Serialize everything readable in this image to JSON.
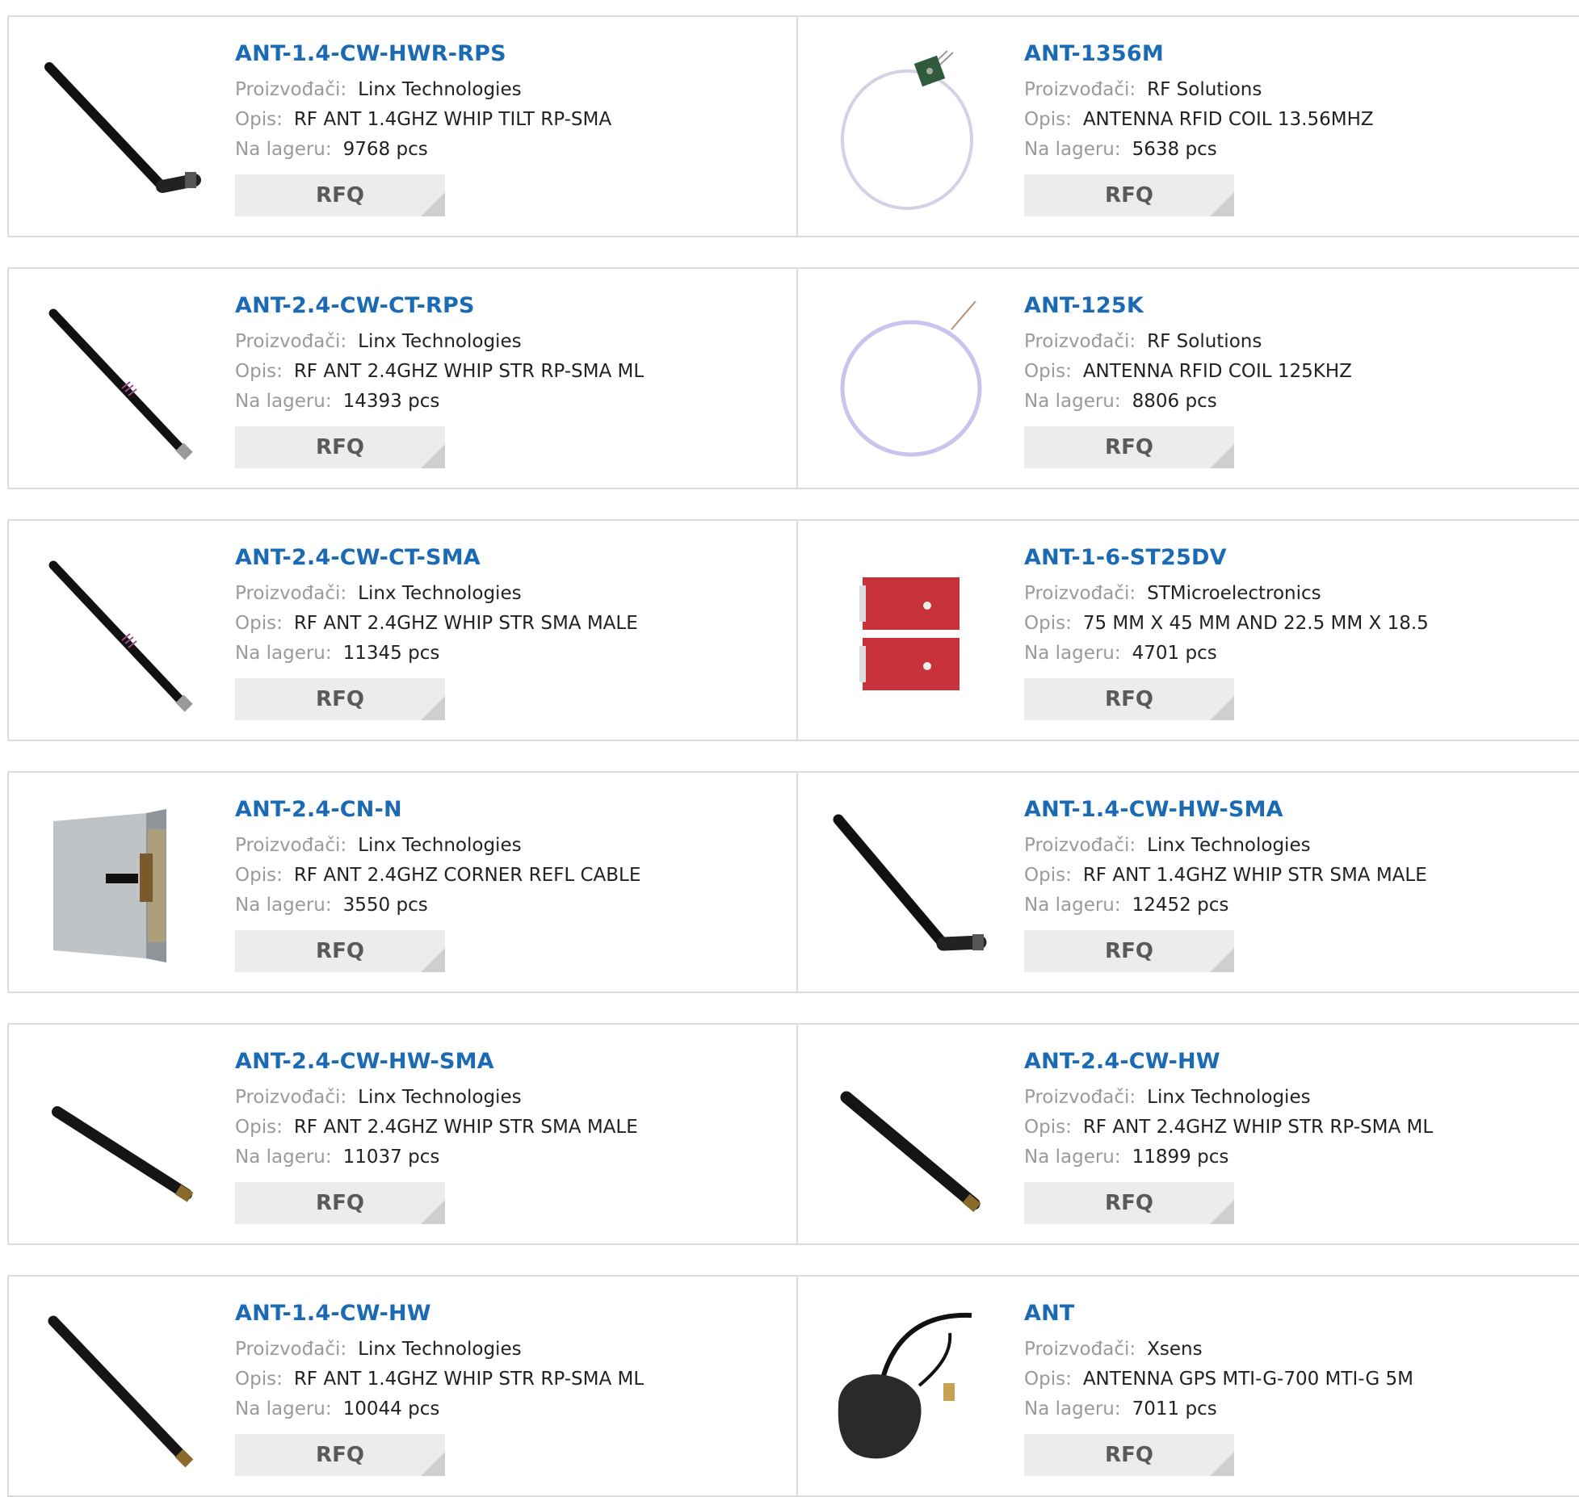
{
  "labels": {
    "manufacturer": "Proizvođači:",
    "description": "Opis:",
    "stock": "Na lageru:",
    "rfq": "RFQ"
  },
  "products": [
    {
      "name": "ANT-1.4-CW-HWR-RPS",
      "manufacturer": "Linx Technologies",
      "description": "RF ANT 1.4GHZ WHIP TILT RP-SMA",
      "stock": "9768 pcs",
      "image": "tilt-whip-antenna"
    },
    {
      "name": "ANT-1356M",
      "manufacturer": "RF Solutions",
      "description": "ANTENNA RFID COIL 13.56MHZ",
      "stock": "5638 pcs",
      "image": "rfid-coil-pcb"
    },
    {
      "name": "ANT-2.4-CW-CT-RPS",
      "manufacturer": "Linx Technologies",
      "description": "RF ANT 2.4GHZ WHIP STR RP-SMA ML",
      "stock": "14393 pcs",
      "image": "straight-whip-striped"
    },
    {
      "name": "ANT-125K",
      "manufacturer": "RF Solutions",
      "description": "ANTENNA RFID COIL 125KHZ",
      "stock": "8806 pcs",
      "image": "rfid-coil"
    },
    {
      "name": "ANT-2.4-CW-CT-SMA",
      "manufacturer": "Linx Technologies",
      "description": "RF ANT 2.4GHZ WHIP STR SMA MALE",
      "stock": "11345 pcs",
      "image": "straight-whip-striped"
    },
    {
      "name": "ANT-1-6-ST25DV",
      "manufacturer": "STMicroelectronics",
      "description": "75 MM X 45 MM AND 22.5 MM X 18.5",
      "stock": "4701 pcs",
      "image": "red-pcb-boards"
    },
    {
      "name": "ANT-2.4-CN-N",
      "manufacturer": "Linx Technologies",
      "description": "RF ANT 2.4GHZ CORNER REFL CABLE",
      "stock": "3550 pcs",
      "image": "corner-reflector"
    },
    {
      "name": "ANT-1.4-CW-HW-SMA",
      "manufacturer": "Linx Technologies",
      "description": "RF ANT 1.4GHZ WHIP STR SMA MALE",
      "stock": "12452 pcs",
      "image": "tilt-whip-antenna"
    },
    {
      "name": "ANT-2.4-CW-HW-SMA",
      "manufacturer": "Linx Technologies",
      "description": "RF ANT 2.4GHZ WHIP STR SMA MALE",
      "stock": "11037 pcs",
      "image": "short-whip"
    },
    {
      "name": "ANT-2.4-CW-HW",
      "manufacturer": "Linx Technologies",
      "description": "RF ANT 2.4GHZ WHIP STR RP-SMA ML",
      "stock": "11899 pcs",
      "image": "short-whip"
    },
    {
      "name": "ANT-1.4-CW-HW",
      "manufacturer": "Linx Technologies",
      "description": "RF ANT 1.4GHZ WHIP STR RP-SMA ML",
      "stock": "10044 pcs",
      "image": "straight-whip"
    },
    {
      "name": "ANT",
      "manufacturer": "Xsens",
      "description": "ANTENNA GPS MTI-G-700 MTI-G 5M",
      "stock": "7011 pcs",
      "image": "gps-puck-antenna"
    }
  ]
}
